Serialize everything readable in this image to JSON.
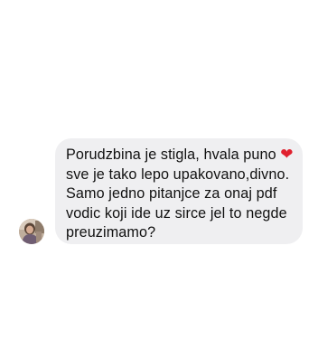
{
  "message": {
    "line_1": "Porudzbina je stigla, hvala puno",
    "heart_emoji": "❤",
    "body": "sve je tako lepo upakovano,divno.\nSamo jedno pitanjce za onaj pdf\nvodic koji ide uz sirce jel to negde\npreuzimamo?"
  },
  "colors": {
    "bubble_background": "#efeff1",
    "text": "#111111",
    "heart": "#e0202e",
    "page_background": "#ffffff"
  },
  "icons": {
    "avatar": "sender-avatar",
    "emoji": "heart-icon"
  }
}
